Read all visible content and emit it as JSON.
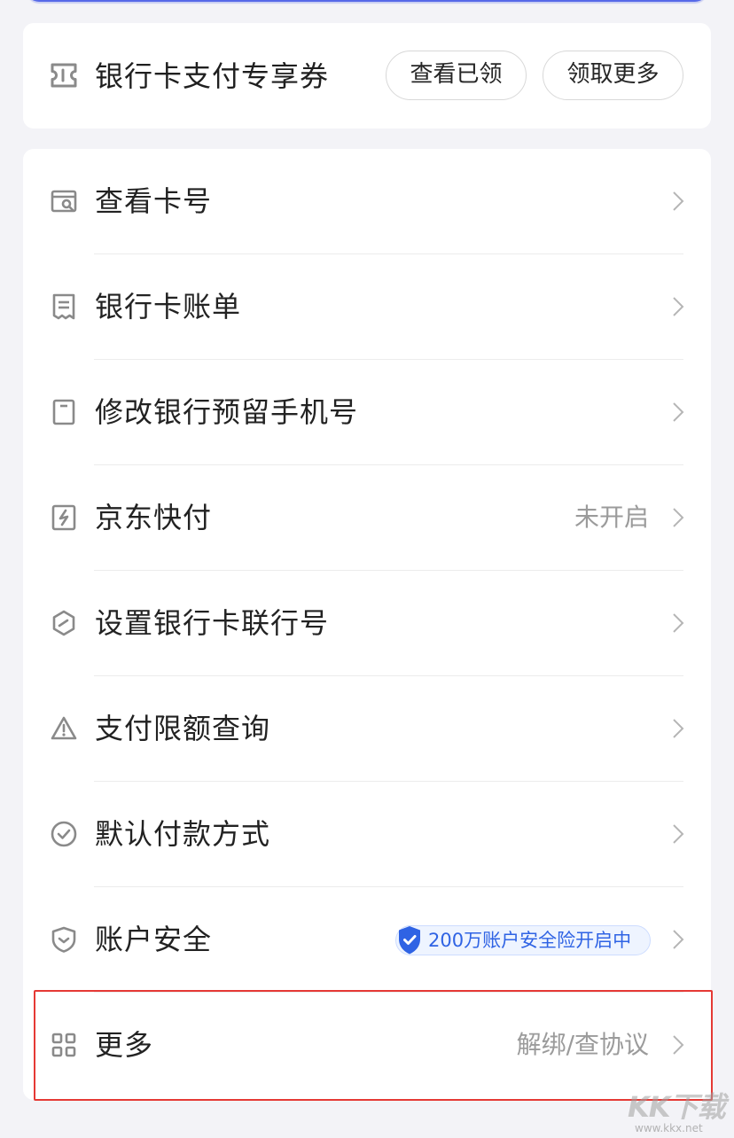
{
  "colors": {
    "background": "#f3f3f7",
    "accent_blue": "#2f63e4",
    "highlight_red": "#e53935",
    "icon_gray": "#8a8a8a"
  },
  "coupon": {
    "icon": "ticket-icon",
    "title": "银行卡支付专享券",
    "view_claimed_label": "查看已领",
    "claim_more_label": "领取更多"
  },
  "menu": {
    "items": [
      {
        "icon": "card-search-icon",
        "label": "查看卡号",
        "value": ""
      },
      {
        "icon": "receipt-icon",
        "label": "银行卡账单",
        "value": ""
      },
      {
        "icon": "phone-icon",
        "label": "修改银行预留手机号",
        "value": ""
      },
      {
        "icon": "lightning-icon",
        "label": "京东快付",
        "value": "未开启"
      },
      {
        "icon": "hexagon-icon",
        "label": "设置银行卡联行号",
        "value": ""
      },
      {
        "icon": "warning-icon",
        "label": "支付限额查询",
        "value": ""
      },
      {
        "icon": "check-circle-icon",
        "label": "默认付款方式",
        "value": ""
      },
      {
        "icon": "shield-icon",
        "label": "账户安全",
        "badge": "200万账户安全险开启中"
      },
      {
        "icon": "grid-icon",
        "label": "更多",
        "value": "解绑/查协议"
      }
    ]
  },
  "watermark": {
    "logo": "KK下载",
    "url": "www.kkx.net"
  }
}
